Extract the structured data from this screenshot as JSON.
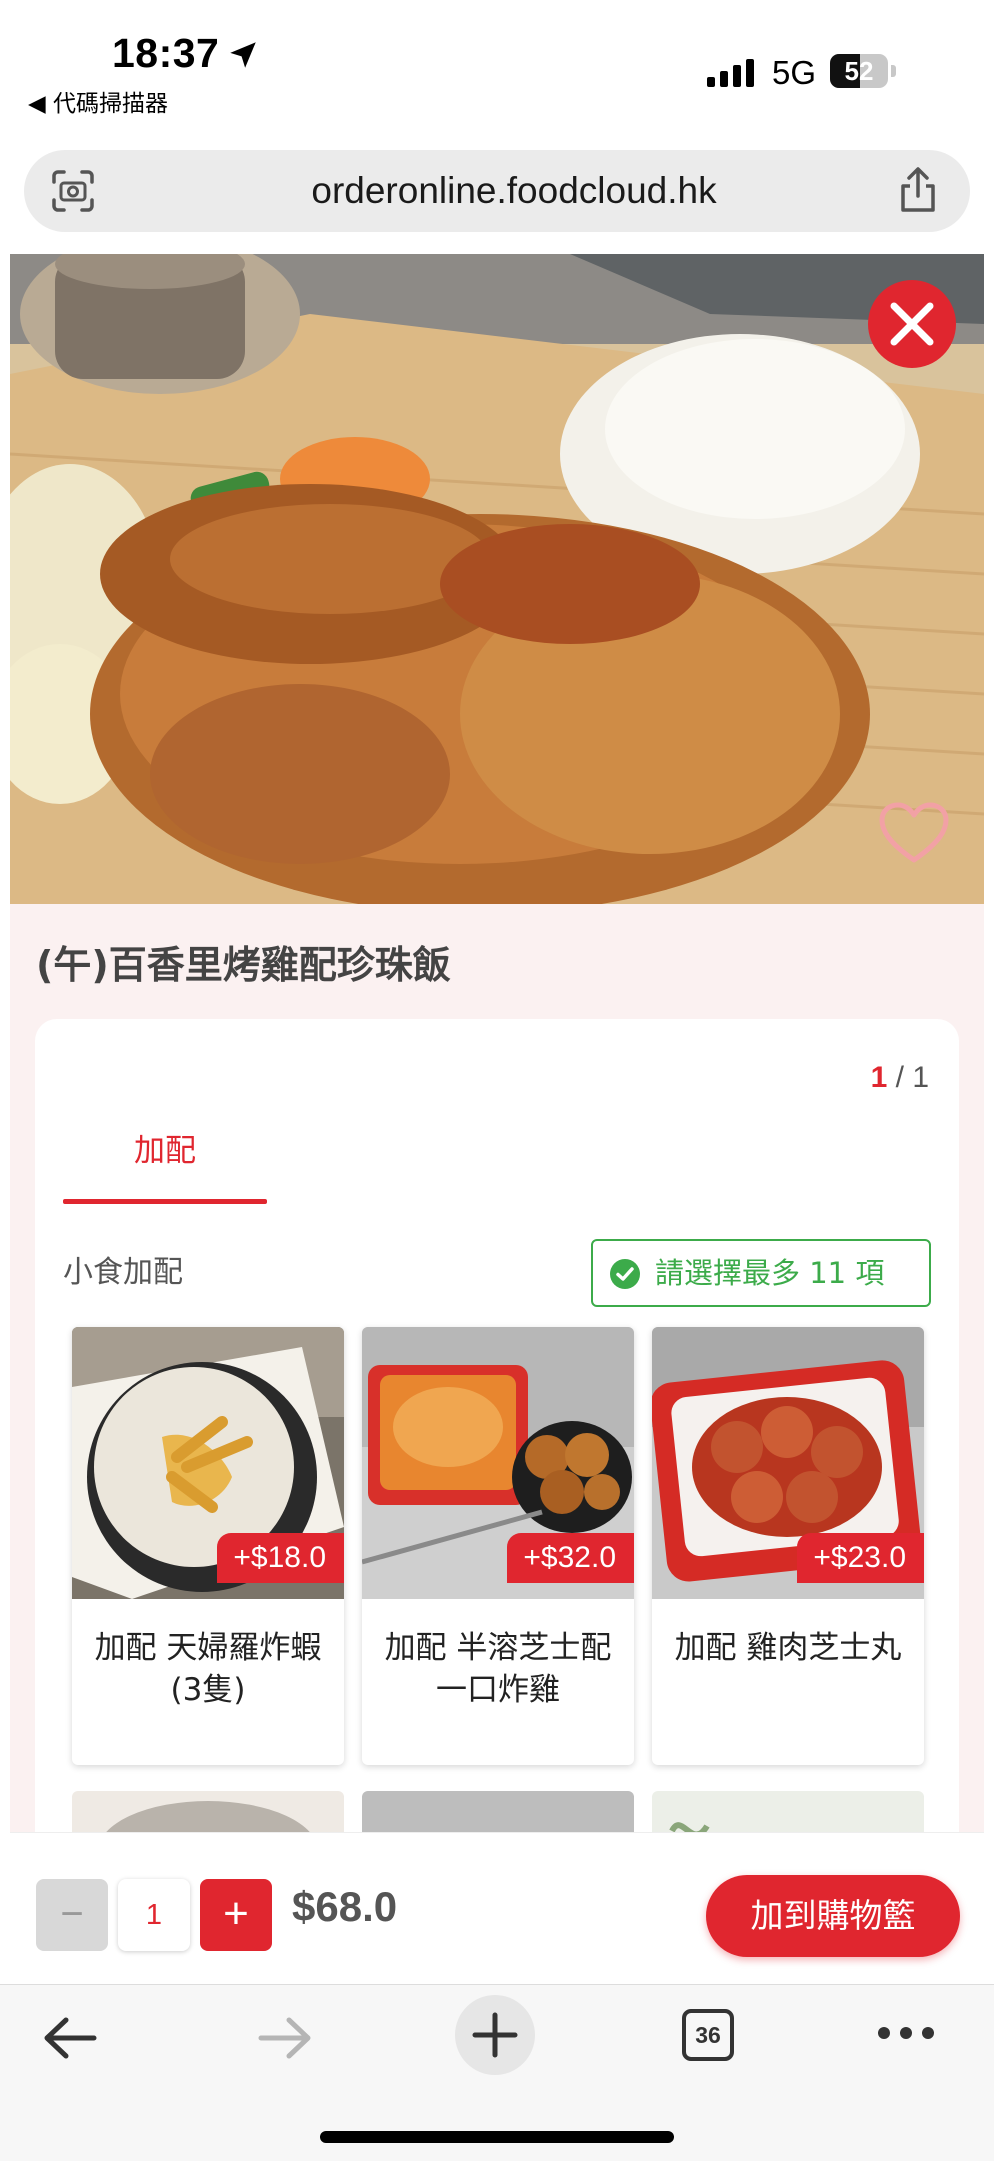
{
  "status_bar": {
    "time": "18:37",
    "back_app": "◀ 代碼掃描器",
    "network": "5G",
    "battery": "52",
    "battery_level": 0.52
  },
  "browser": {
    "url": "orderonline.foodcloud.hk",
    "tab_count": "36"
  },
  "product": {
    "title": "(午)百香里烤雞配珍珠飯",
    "pager_current": "1",
    "pager_sep": " / ",
    "pager_total": "1",
    "tab_label": "加配",
    "group_label": "小食加配",
    "rule_text": "請選擇最多 11 項"
  },
  "addons": [
    {
      "price": "+$18.0",
      "name": "加配 天婦羅炸蝦(3隻)"
    },
    {
      "price": "+$32.0",
      "name": "加配 半溶芝士配一口炸雞"
    },
    {
      "price": "+$23.0",
      "name": "加配 雞肉芝士丸"
    }
  ],
  "order": {
    "minus": "−",
    "quantity": "1",
    "plus": "+",
    "total": "$68.0",
    "add_to_cart": "加到購物籃"
  },
  "colors": {
    "accent": "#e0262f",
    "success": "#3cab4a",
    "page_bg": "#fbf1f1"
  }
}
